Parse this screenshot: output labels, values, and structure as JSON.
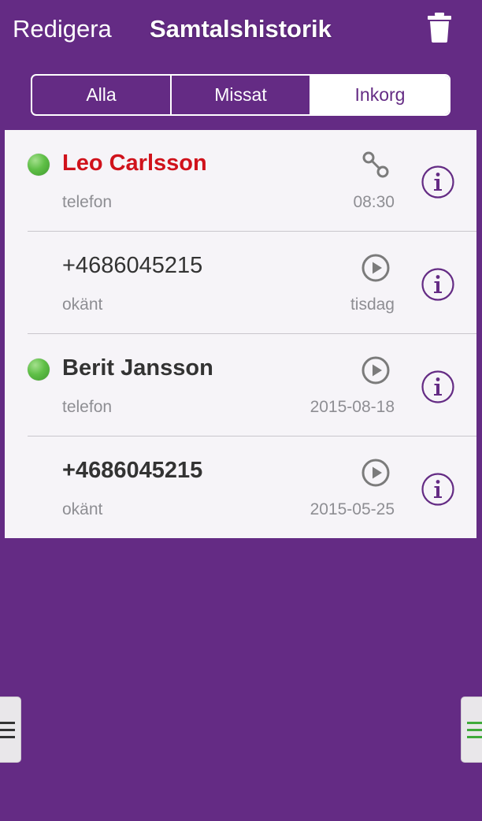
{
  "header": {
    "edit_label": "Redigera",
    "title": "Samtalshistorik",
    "trash_icon": "trash-icon"
  },
  "filter_tabs": [
    {
      "label": "Alla",
      "active": false
    },
    {
      "label": "Missat",
      "active": false
    },
    {
      "label": "Inkorg",
      "active": true
    }
  ],
  "calls": [
    {
      "name": "Leo Carlsson",
      "type": "telefon",
      "time": "08:30",
      "status_icon": "voicemail-icon",
      "presence": true,
      "missed": true
    },
    {
      "name": "+4686045215",
      "type": "okänt",
      "time": "tisdag",
      "status_icon": "play-icon",
      "presence": false,
      "missed": false
    },
    {
      "name": "Berit Jansson",
      "type": "telefon",
      "time": "2015-08-18",
      "status_icon": "play-icon",
      "presence": true,
      "missed": false
    },
    {
      "name": "+4686045215",
      "type": "okänt",
      "time": "2015-05-25",
      "status_icon": "play-icon",
      "presence": false,
      "missed": false
    }
  ],
  "colors": {
    "background": "#642b84",
    "list_background": "#f6f4f8",
    "missed_name": "#d0121b",
    "presence_green": "#5fbf47",
    "info_purple": "#642b84",
    "secondary_text": "#8e8e93"
  },
  "side_handles": {
    "left_icon": "menu-icon",
    "right_icon": "menu-icon"
  }
}
